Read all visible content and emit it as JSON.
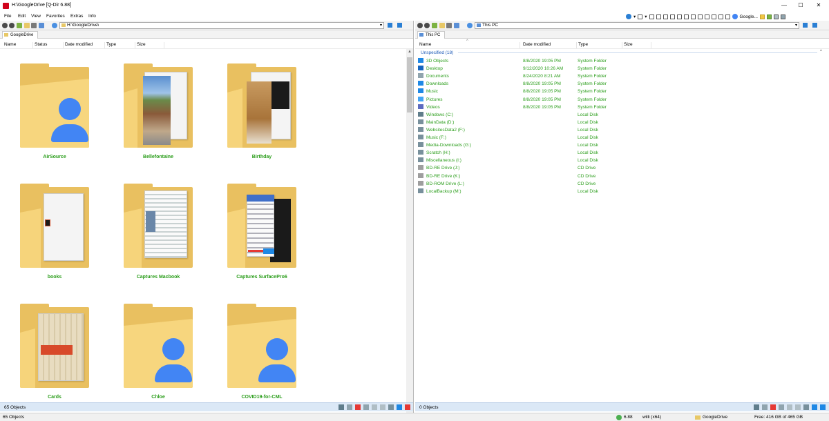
{
  "window": {
    "title": "H:\\GoogleDrive  [Q-Dir 6.88]",
    "minimize": "—",
    "maximize": "☐",
    "close": "✕"
  },
  "menu": [
    "File",
    "Edit",
    "View",
    "Favorites",
    "Extras",
    "Info"
  ],
  "toolbar_right": {
    "search_label": "Google..."
  },
  "left_pane": {
    "address": "H:\\GoogleDrive\\",
    "tab": "GoogleDrive",
    "columns": [
      "Name",
      "Status",
      "Date modified",
      "Type",
      "Size"
    ],
    "items": [
      {
        "label": "AirSource",
        "thumb": "shared-folder-icon"
      },
      {
        "label": "Bellefontaine",
        "thumb": "photo-folder-icon"
      },
      {
        "label": "Birthday",
        "thumb": "photo-folder-icon"
      },
      {
        "label": "books",
        "thumb": "document-folder-icon"
      },
      {
        "label": "Captures Macbook",
        "thumb": "document-folder-icon"
      },
      {
        "label": "Captures SurfacePro6",
        "thumb": "screenshot-folder-icon"
      },
      {
        "label": "Cards",
        "thumb": "document-folder-icon"
      },
      {
        "label": "Chloe",
        "thumb": "shared-folder-icon"
      },
      {
        "label": "COVID19-for-CML",
        "thumb": "shared-folder-icon"
      }
    ],
    "status": "65 Objects"
  },
  "right_pane": {
    "address": "This PC",
    "tab": "This PC",
    "columns": [
      "Name",
      "Date modified",
      "Type",
      "Size"
    ],
    "group": "Unspecified (18)",
    "rows": [
      {
        "name": "3D Objects",
        "date": "8/8/2020 19:05 PM",
        "type": "System Folder",
        "icon": "3d-objects-icon",
        "color": "#1e88e5"
      },
      {
        "name": "Desktop",
        "date": "9/12/2020 10:26 AM",
        "type": "System Folder",
        "icon": "desktop-icon",
        "color": "#1565c0"
      },
      {
        "name": "Documents",
        "date": "8/24/2020 8:21 AM",
        "type": "System Folder",
        "icon": "documents-icon",
        "color": "#90a4ae"
      },
      {
        "name": "Downloads",
        "date": "8/8/2020 19:05 PM",
        "type": "System Folder",
        "icon": "downloads-icon",
        "color": "#1e88e5"
      },
      {
        "name": "Music",
        "date": "8/8/2020 19:05 PM",
        "type": "System Folder",
        "icon": "music-icon",
        "color": "#1e88e5"
      },
      {
        "name": "Pictures",
        "date": "8/8/2020 19:05 PM",
        "type": "System Folder",
        "icon": "pictures-icon",
        "color": "#42a5f5"
      },
      {
        "name": "Videos",
        "date": "8/8/2020 19:05 PM",
        "type": "System Folder",
        "icon": "videos-icon",
        "color": "#5c6bc0"
      },
      {
        "name": "Windows (C:)",
        "date": "",
        "type": "Local Disk",
        "icon": "windows-drive-icon",
        "color": "#607d8b"
      },
      {
        "name": "MainData (D:)",
        "date": "",
        "type": "Local Disk",
        "icon": "drive-icon",
        "color": "#78909c"
      },
      {
        "name": "WebsitesData2 (F:)",
        "date": "",
        "type": "Local Disk",
        "icon": "drive-icon",
        "color": "#78909c"
      },
      {
        "name": "Music (F:)",
        "date": "",
        "type": "Local Disk",
        "icon": "drive-icon",
        "color": "#78909c"
      },
      {
        "name": "Media-Downloads (G:)",
        "date": "",
        "type": "Local Disk",
        "icon": "drive-icon",
        "color": "#78909c"
      },
      {
        "name": "Scratch (H:)",
        "date": "",
        "type": "Local Disk",
        "icon": "drive-icon",
        "color": "#78909c"
      },
      {
        "name": "Miscellaneous (I:)",
        "date": "",
        "type": "Local Disk",
        "icon": "drive-icon",
        "color": "#78909c"
      },
      {
        "name": "BD-RE Drive (J:)",
        "date": "",
        "type": "CD Drive",
        "icon": "optical-drive-icon",
        "color": "#9e9e9e"
      },
      {
        "name": "BD-RE Drive (K:)",
        "date": "",
        "type": "CD Drive",
        "icon": "optical-drive-icon",
        "color": "#9e9e9e"
      },
      {
        "name": "BD-ROM Drive (L:)",
        "date": "",
        "type": "CD Drive",
        "icon": "optical-drive-icon",
        "color": "#9e9e9e"
      },
      {
        "name": "LocalBackup (M:)",
        "date": "",
        "type": "Local Disk",
        "icon": "drive-icon",
        "color": "#78909c"
      }
    ],
    "status": "0 Objects"
  },
  "statusbar": {
    "objects": "65 Objects",
    "version": "6.88",
    "user": "willi  (x64)",
    "location": "GoogleDrive",
    "free": "Free: 416 GB of 465 GB"
  },
  "colors": {
    "label_green": "#2a9d1a",
    "group_blue": "#1e5bb8",
    "folder": "#f7d67e",
    "person": "#4285f4"
  }
}
